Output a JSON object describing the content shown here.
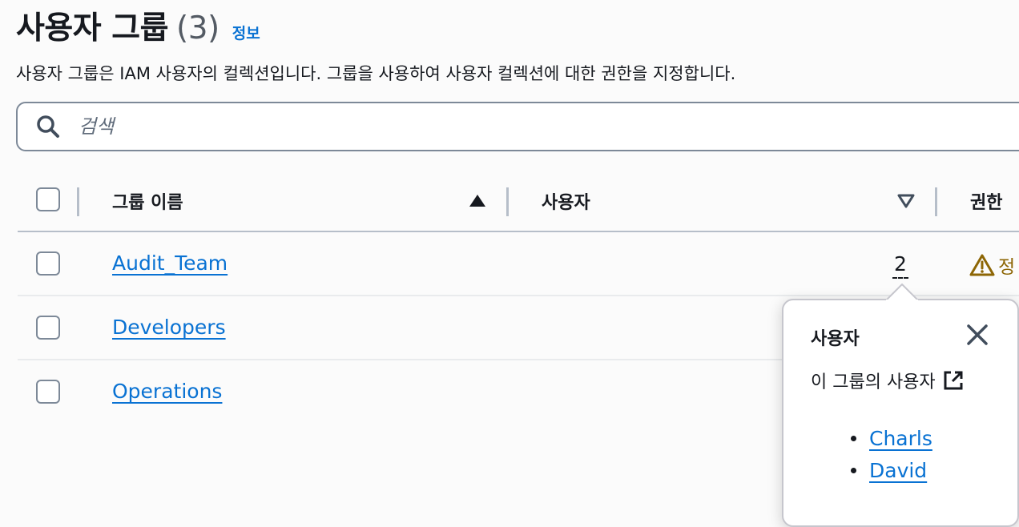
{
  "header": {
    "title": "사용자 그룹",
    "count": "(3)",
    "info_label": "정보",
    "description": "사용자 그룹은 IAM 사용자의 컬렉션입니다. 그룹을 사용하여 사용자 컬렉션에 대한 권한을 지정합니다."
  },
  "search": {
    "placeholder": "검색",
    "value": ""
  },
  "table": {
    "columns": [
      {
        "label": "그룹 이름",
        "sort": "ascending"
      },
      {
        "label": "사용자",
        "sort": "descending"
      },
      {
        "label": "권한"
      }
    ],
    "rows": [
      {
        "name": "Audit_Team",
        "users": "2",
        "permission": "정"
      },
      {
        "name": "Developers"
      },
      {
        "name": "Operations"
      }
    ]
  },
  "popover": {
    "title": "사용자",
    "subtitle": "이 그룹의 사용자",
    "users": [
      "Charls",
      "David"
    ]
  },
  "icons": {
    "search": "search-icon",
    "sort_up": "sort-ascending-icon",
    "sort_down": "sort-descending-icon",
    "warning": "warning-icon",
    "close": "close-icon",
    "external_link": "external-link-icon"
  },
  "colors": {
    "link": "#0972d3",
    "warning": "#8d6605",
    "text": "#16191f"
  }
}
